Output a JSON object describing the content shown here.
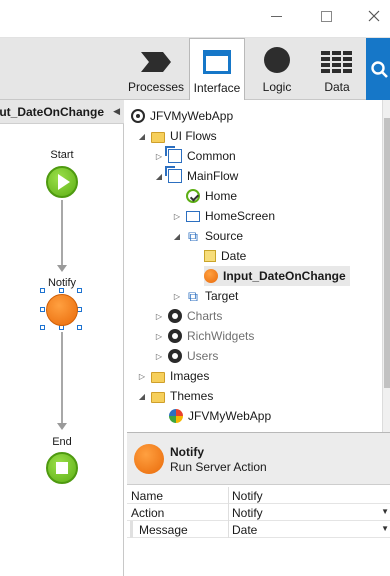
{
  "window": {
    "controls": {
      "minimize": "minimize",
      "maximize": "maximize",
      "close": "close"
    }
  },
  "toolbar": {
    "tabs": [
      {
        "label": "Processes",
        "icon": "processes-icon",
        "active": false
      },
      {
        "label": "Interface",
        "icon": "interface-icon",
        "active": true
      },
      {
        "label": "Logic",
        "icon": "logic-icon",
        "active": false
      },
      {
        "label": "Data",
        "icon": "data-icon",
        "active": false
      }
    ],
    "search_icon": "search-icon"
  },
  "canvas": {
    "title": "Input_DateOnChange",
    "nodes": {
      "start": "Start",
      "notify": "Notify",
      "end": "End"
    }
  },
  "tree": {
    "items": [
      {
        "label": "JFVMyWebApp"
      },
      {
        "label": "UI Flows"
      },
      {
        "label": "Common"
      },
      {
        "label": "MainFlow"
      },
      {
        "label": "Home"
      },
      {
        "label": "HomeScreen"
      },
      {
        "label": "Source"
      },
      {
        "label": "Date"
      },
      {
        "label": "Input_DateOnChange"
      },
      {
        "label": "Target"
      },
      {
        "label": "Charts"
      },
      {
        "label": "RichWidgets"
      },
      {
        "label": "Users"
      },
      {
        "label": "Images"
      },
      {
        "label": "Themes"
      },
      {
        "label": "JFVMyWebApp"
      }
    ]
  },
  "properties": {
    "element_name": "Notify",
    "element_type": "Run Server Action",
    "rows": [
      {
        "key": "Name",
        "value": "Notify"
      },
      {
        "key": "Action",
        "value": "Notify"
      },
      {
        "key": "Message",
        "value": "Date"
      }
    ]
  },
  "colors": {
    "accent": "#1677c8",
    "start_end_green": "#5cae14",
    "action_orange": "#e96a0a"
  }
}
